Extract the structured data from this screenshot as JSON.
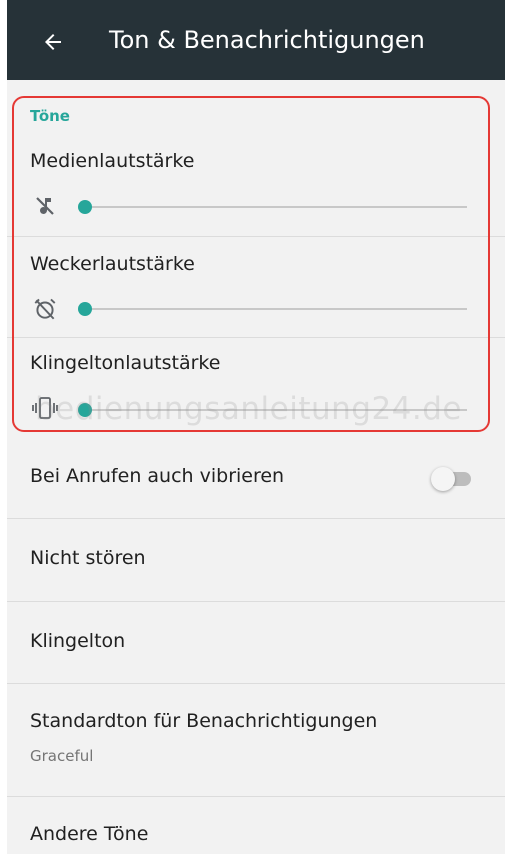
{
  "header": {
    "title": "Ton & Benachrichtigungen",
    "back_icon": "arrow-back-icon",
    "background": "#263238"
  },
  "sounds": {
    "section_label": "Töne",
    "sliders": [
      {
        "label": "Medienlautstärke",
        "icon": "music-off-icon",
        "level": 0
      },
      {
        "label": "Weckerlautstärke",
        "icon": "alarm-off-icon",
        "level": 0
      },
      {
        "label": "Klingeltonlautstärke",
        "icon": "vibrate-icon",
        "level": 0
      }
    ],
    "accent": "#26a69a",
    "highlight_color": "#e53935"
  },
  "settings": {
    "vibrate_label": "Bei Anrufen auch vibrieren",
    "vibrate_on": false,
    "dnd_label": "Nicht stören",
    "ringtone_label": "Klingelton",
    "notification_label": "Standardton für Benachrichtigungen",
    "notification_value": "Graceful",
    "other_label": "Andere Töne"
  },
  "watermark": "bedienungsanleitung24.de"
}
